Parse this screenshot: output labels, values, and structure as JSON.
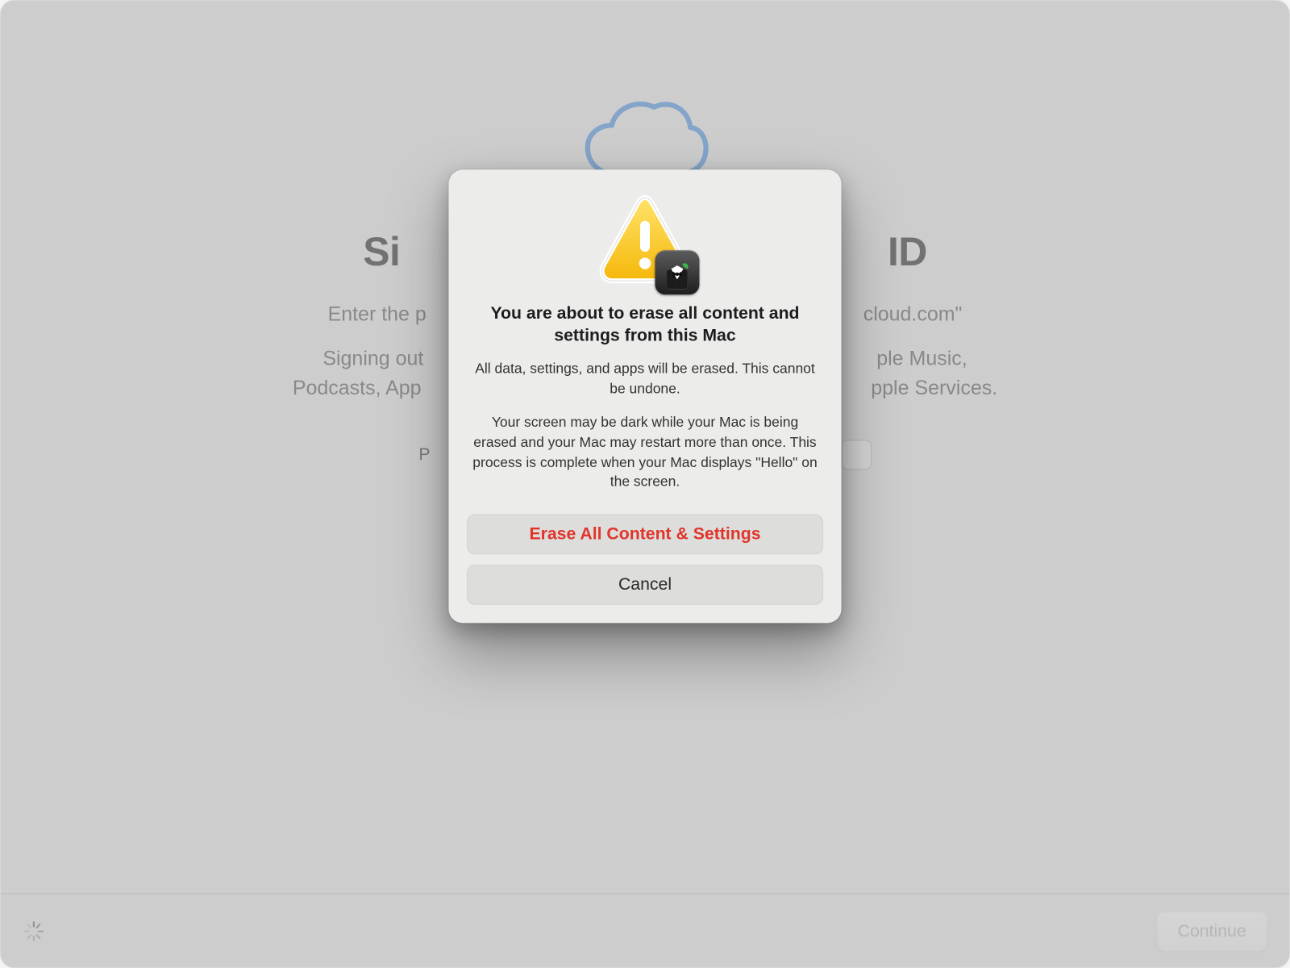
{
  "background": {
    "title_visible_left": "Si",
    "title_visible_right": "ID",
    "line1_left": "Enter the p",
    "line1_right": "cloud.com\"",
    "line2a_left": "Signing out",
    "line2a_right": "ple Music,",
    "line2b_left": "Podcasts, App",
    "line2b_right": "pple Services.",
    "password_label_fragment": "P"
  },
  "modal": {
    "title": "You are about to erase all content and settings from this Mac",
    "body1": "All data, settings, and apps will be erased. This cannot be undone.",
    "body2": "Your screen may be dark while your Mac is being erased and your Mac may restart more than once. This process is complete when your Mac displays \"Hello\" on the screen.",
    "erase_button": "Erase All Content & Settings",
    "cancel_button": "Cancel"
  },
  "footer": {
    "continue_button": "Continue"
  },
  "colors": {
    "destructive": "#e0352b",
    "cloud_stroke": "#4a90e2"
  }
}
